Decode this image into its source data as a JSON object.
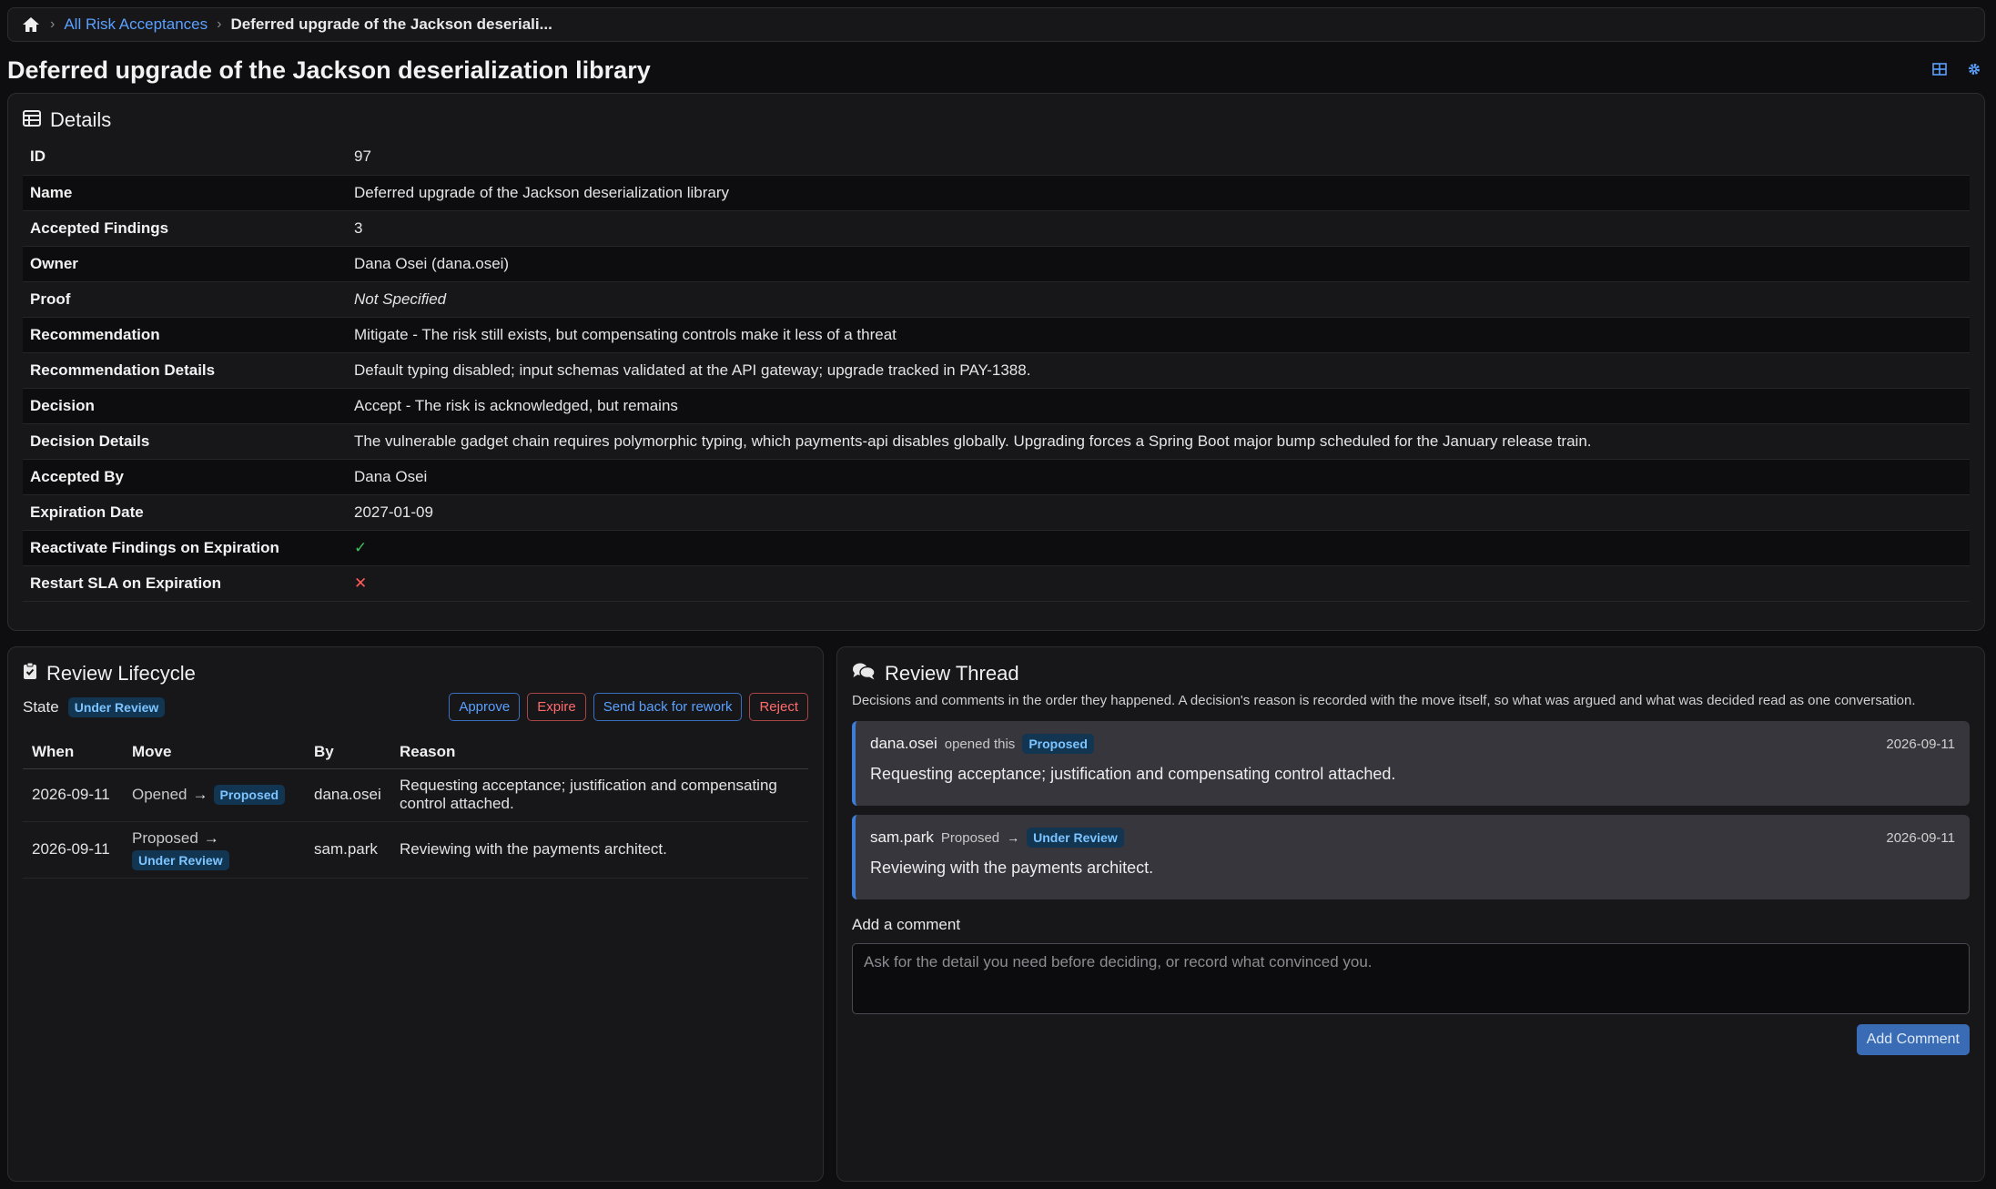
{
  "breadcrumb": {
    "home_icon": "home-icon",
    "link_label": "All Risk Acceptances",
    "current_label": "Deferred upgrade of the Jackson deseriali..."
  },
  "page": {
    "title": "Deferred upgrade of the Jackson deserialization library",
    "icons": [
      "grid-icon",
      "gear-icon"
    ]
  },
  "details": {
    "title": "Details",
    "rows": [
      {
        "label": "ID",
        "value": "97"
      },
      {
        "label": "Name",
        "value": "Deferred upgrade of the Jackson deserialization library"
      },
      {
        "label": "Accepted Findings",
        "value": "3"
      },
      {
        "label": "Owner",
        "value": "Dana Osei (dana.osei)"
      },
      {
        "label": "Proof",
        "value": "Not Specified"
      },
      {
        "label": "Recommendation",
        "value": "Mitigate - The risk still exists, but compensating controls make it less of a threat"
      },
      {
        "label": "Recommendation Details",
        "value": "Default typing disabled; input schemas validated at the API gateway; upgrade tracked in PAY-1388."
      },
      {
        "label": "Decision",
        "value": "Accept - The risk is acknowledged, but remains"
      },
      {
        "label": "Decision Details",
        "value": "The vulnerable gadget chain requires polymorphic typing, which payments-api disables globally. Upgrading forces a Spring Boot major bump scheduled for the January release train."
      },
      {
        "label": "Accepted By",
        "value": "Dana Osei"
      },
      {
        "label": "Expiration Date",
        "value": "2027-01-09"
      },
      {
        "label": "Reactivate Findings on Expiration",
        "value": "✓"
      },
      {
        "label": "Restart SLA on Expiration",
        "value": "✕"
      }
    ],
    "colors": {
      "check": "#3fbf5f",
      "cross": "#ff5a5a"
    }
  },
  "lifecycle": {
    "title": "Review Lifecycle",
    "state_label": "State",
    "state_value": "Under Review",
    "actions": {
      "approve": "Approve",
      "expire": "Expire",
      "rework": "Send back for rework",
      "reject": "Reject"
    },
    "columns": {
      "when": "When",
      "move": "Move",
      "by": "By",
      "reason": "Reason"
    },
    "rows": [
      {
        "when": "2026-09-11",
        "from": "Opened",
        "to": "Proposed",
        "by": "dana.osei",
        "reason": "Requesting acceptance; justification and compensating control attached."
      },
      {
        "when": "2026-09-11",
        "from": "Proposed",
        "to": "Under Review",
        "by": "sam.park",
        "reason": "Reviewing with the payments architect."
      }
    ]
  },
  "thread": {
    "title": "Review Thread",
    "description": "Decisions and comments in the order they happened. A decision's reason is recorded with the move itself, so what was argued and what was decided read as one conversation.",
    "messages": [
      {
        "user": "dana.osei",
        "action": "opened this",
        "badge": "Proposed",
        "date": "2026-09-11",
        "body": "Requesting acceptance; justification and compensating control attached."
      },
      {
        "user": "sam.park",
        "action": "Proposed",
        "badge": "Under Review",
        "date": "2026-09-11",
        "body": "Reviewing with the payments architect."
      }
    ],
    "add_label": "Add a comment",
    "placeholder": "Ask for the detail you need before deciding, or record what convinced you.",
    "submit_label": "Add Comment"
  }
}
